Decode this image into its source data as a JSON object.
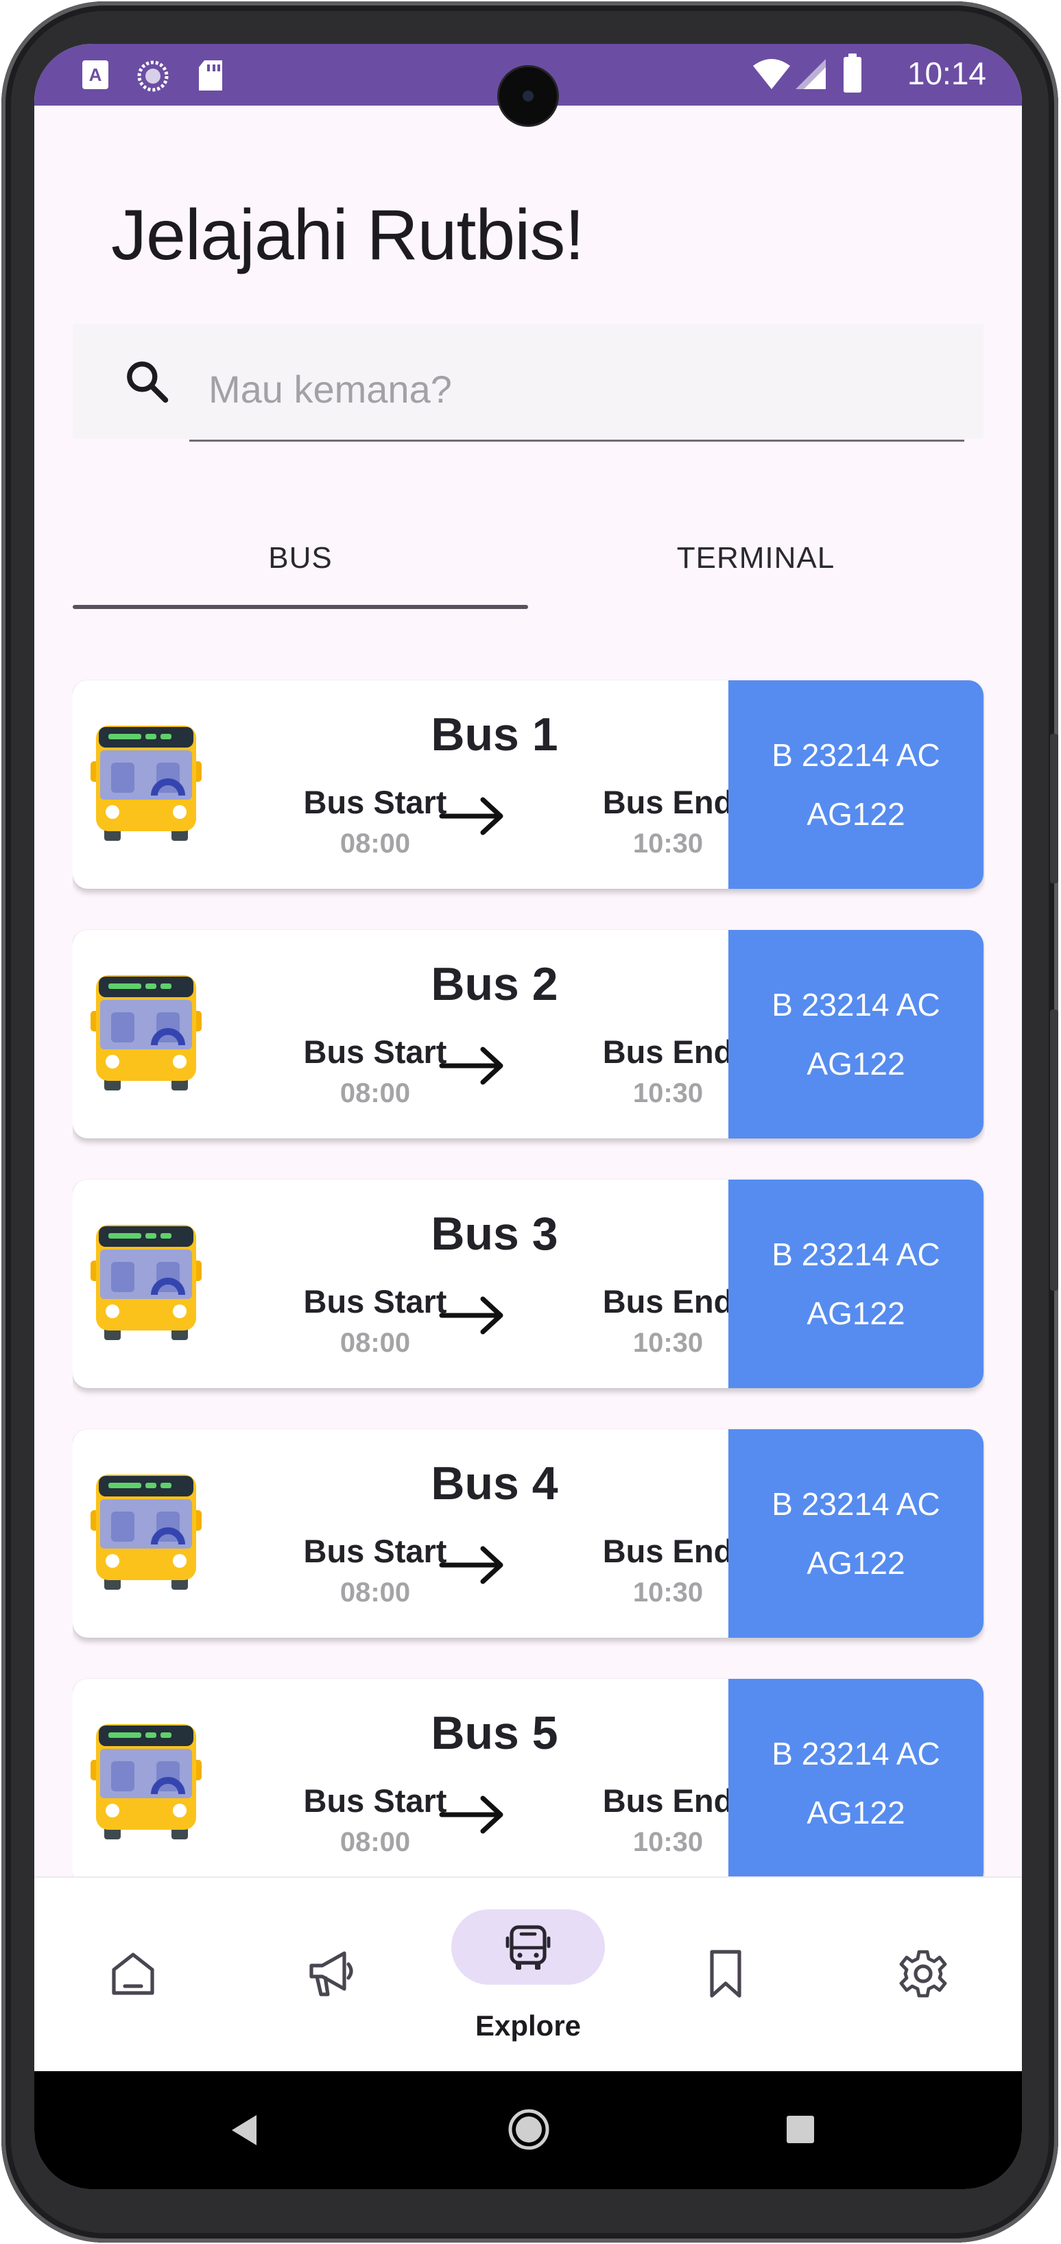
{
  "status_bar": {
    "time": "10:14",
    "left_icons": [
      "keyboard-a-icon",
      "loading-circle-icon",
      "sd-card-icon"
    ],
    "right_icons": [
      "wifi-icon",
      "signal-icon",
      "battery-icon"
    ],
    "color": "#6b4ea3"
  },
  "header": {
    "title": "Jelajahi Rutbis!"
  },
  "search": {
    "placeholder": "Mau kemana?",
    "value": ""
  },
  "tabs": [
    {
      "label": "BUS",
      "active": true
    },
    {
      "label": "TERMINAL",
      "active": false
    }
  ],
  "buses": [
    {
      "name": "Bus 1",
      "start_label": "Bus Start",
      "start_time": "08:00",
      "end_label": "Bus End",
      "end_time": "10:30",
      "plate": "B 23214 AC",
      "code": "AG122"
    },
    {
      "name": "Bus 2",
      "start_label": "Bus Start",
      "start_time": "08:00",
      "end_label": "Bus End",
      "end_time": "10:30",
      "plate": "B 23214 AC",
      "code": "AG122"
    },
    {
      "name": "Bus 3",
      "start_label": "Bus Start",
      "start_time": "08:00",
      "end_label": "Bus End",
      "end_time": "10:30",
      "plate": "B 23214 AC",
      "code": "AG122"
    },
    {
      "name": "Bus 4",
      "start_label": "Bus Start",
      "start_time": "08:00",
      "end_label": "Bus End",
      "end_time": "10:30",
      "plate": "B 23214 AC",
      "code": "AG122"
    },
    {
      "name": "Bus 5",
      "start_label": "Bus Start",
      "start_time": "08:00",
      "end_label": "Bus End",
      "end_time": "10:30",
      "plate": "B 23214 AC",
      "code": "AG122"
    }
  ],
  "bottom_nav": {
    "items": [
      {
        "icon": "home-icon",
        "active": false
      },
      {
        "icon": "megaphone-icon",
        "active": false
      },
      {
        "icon": "bus-icon",
        "label": "Explore",
        "active": true
      },
      {
        "icon": "bookmark-icon",
        "active": false
      },
      {
        "icon": "gear-icon",
        "active": false
      }
    ]
  },
  "system_nav": {
    "icons": [
      "back-icon",
      "home-circle-icon",
      "recents-icon"
    ]
  },
  "colors": {
    "accent": "#568cef",
    "status_bar": "#6b4ea3",
    "explore_pill": "#e8ddf6",
    "background": "#fdf6fd"
  }
}
